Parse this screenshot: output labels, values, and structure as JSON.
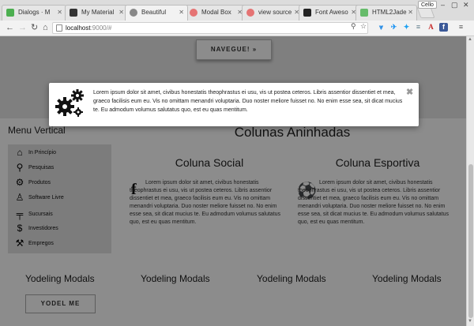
{
  "browser": {
    "tabs": [
      {
        "title": "Dialogs · M",
        "favicon_color": "#4caf50"
      },
      {
        "title": "My Material",
        "favicon_color": "#333333"
      },
      {
        "title": "Beautiful",
        "favicon_color": "#888888"
      },
      {
        "title": "Modal Box",
        "favicon_color": "#e57373"
      },
      {
        "title": "view source",
        "favicon_color": "#e57373"
      },
      {
        "title": "Font Aweso",
        "favicon_color": "#222222"
      },
      {
        "title": "HTML2Jade",
        "favicon_color": "#66bb6a"
      }
    ],
    "profile_label": "Cello",
    "url_host": "localhost",
    "url_rest": ":9000/#"
  },
  "hero": {
    "cta_label": "NAVEGUE! »"
  },
  "menu": {
    "title": "Menu Vertical",
    "items": [
      {
        "label": "In Princípio",
        "icon": "home-icon",
        "glyph": "⌂"
      },
      {
        "label": "Pesquisas",
        "icon": "search-icon",
        "glyph": "⚲"
      },
      {
        "label": "Produtos",
        "icon": "gears-icon",
        "glyph": "⚙"
      },
      {
        "label": "Software Livre",
        "icon": "linux-icon",
        "glyph": "♙"
      },
      {
        "label": "Sucursais",
        "icon": "signpost-icon",
        "glyph": "╤"
      },
      {
        "label": "Investidores",
        "icon": "dollar-icon",
        "glyph": "$"
      },
      {
        "label": "Empregos",
        "icon": "wrench-icon",
        "glyph": "⚒"
      }
    ]
  },
  "main": {
    "title": "Colunas Aninhadas",
    "columns": [
      {
        "title": "Coluna Social",
        "icon": "facebook-icon",
        "glyph": "f",
        "text": "Lorem ipsum dolor sit amet, civibus honestatis theophrastus ei usu, vis ut postea ceteros. Libris assentior dissentiet et mea, graeco facilisis eum eu. Vis no omittam menandri voluptaria. Duo noster meliore fuisset no. No enim esse sea, sit dicat mucius te. Eu admodum volumus salutatus quo, est eu quas mentitum."
      },
      {
        "title": "Coluna Esportiva",
        "icon": "soccer-ball-icon",
        "glyph": "⚽",
        "text": "Lorem ipsum dolor sit amet, civibus honestatis theophrastus ei usu, vis ut postea ceteros. Libris assentior dissentiet et mea, graeco facilisis eum eu. Vis no omittam menandri voluptaria. Duo noster meliore fuisset no. No enim esse sea, sit dicat mucius te. Eu admodum volumus salutatus quo, est eu quas mentitum."
      }
    ]
  },
  "yodel": {
    "headings": [
      "Yodeling Modals",
      "Yodeling Modals",
      "Yodeling Modals",
      "Yodeling Modals"
    ],
    "button_label": "YODEL ME"
  },
  "modal": {
    "icon": "gears-icon",
    "text": "Lorem ipsum dolor sit amet, civibus honestatis theophrastus ei usu, vis ut postea ceteros. Libris assentior dissentiet et mea, graeco facilisis eum eu. Vis no omittam menandri voluptaria. Duo noster meliore fuisset no. No enim esse sea, sit dicat mucius te. Eu admodum volumus salutatus quo, est eu quas mentitum.",
    "close_glyph": "✖"
  }
}
